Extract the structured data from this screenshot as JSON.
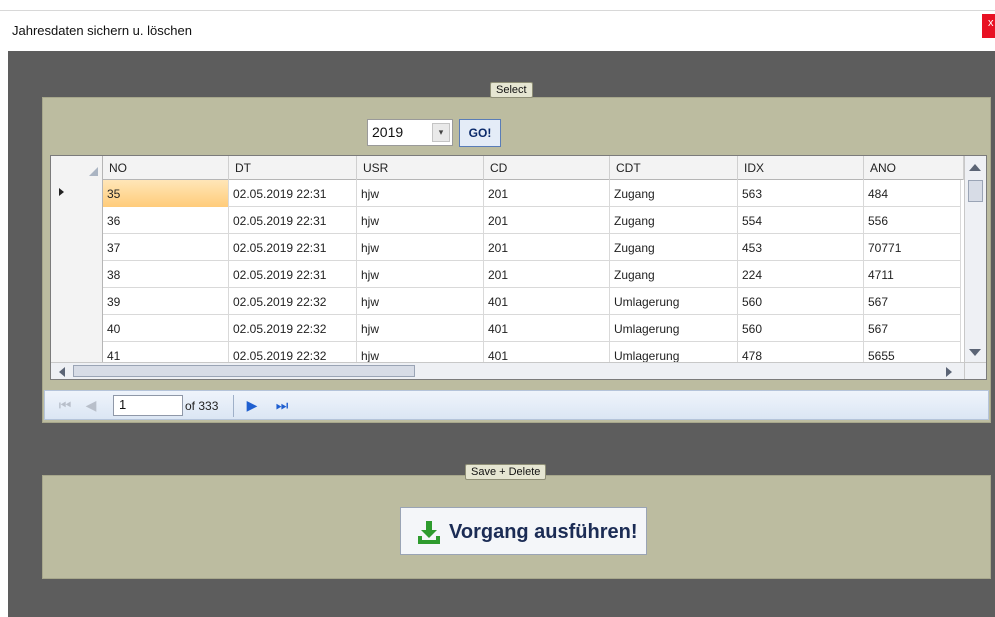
{
  "window": {
    "title": "Jahresdaten sichern u. löschen"
  },
  "select_group": {
    "legend": "Select",
    "year": "2019",
    "go_label": "GO!"
  },
  "grid": {
    "columns": [
      "NO",
      "DT",
      "USR",
      "CD",
      "CDT",
      "IDX",
      "ANO"
    ],
    "rows": [
      [
        "35",
        "02.05.2019 22:31",
        "hjw",
        "201",
        "Zugang",
        "563",
        "484"
      ],
      [
        "36",
        "02.05.2019 22:31",
        "hjw",
        "201",
        "Zugang",
        "554",
        "556"
      ],
      [
        "37",
        "02.05.2019 22:31",
        "hjw",
        "201",
        "Zugang",
        "453",
        "70771"
      ],
      [
        "38",
        "02.05.2019 22:31",
        "hjw",
        "201",
        "Zugang",
        "224",
        "4711"
      ],
      [
        "39",
        "02.05.2019 22:32",
        "hjw",
        "401",
        "Umlagerung",
        "560",
        "567"
      ],
      [
        "40",
        "02.05.2019 22:32",
        "hjw",
        "401",
        "Umlagerung",
        "560",
        "567"
      ],
      [
        "41",
        "02.05.2019 22:32",
        "hjw",
        "401",
        "Umlagerung",
        "478",
        "5655"
      ]
    ]
  },
  "navigator": {
    "page": "1",
    "of_label": "of 333"
  },
  "save_group": {
    "legend": "Save + Delete",
    "execute_label": "Vorgang ausführen!"
  },
  "colors": {
    "client_bg": "#5d5d5d",
    "panel_bg": "#bcbca0",
    "selected_cell": "#ffcc7a",
    "icon_green": "#2e9b2e"
  },
  "icons": {
    "close": "close-icon",
    "execute": "download-icon"
  }
}
